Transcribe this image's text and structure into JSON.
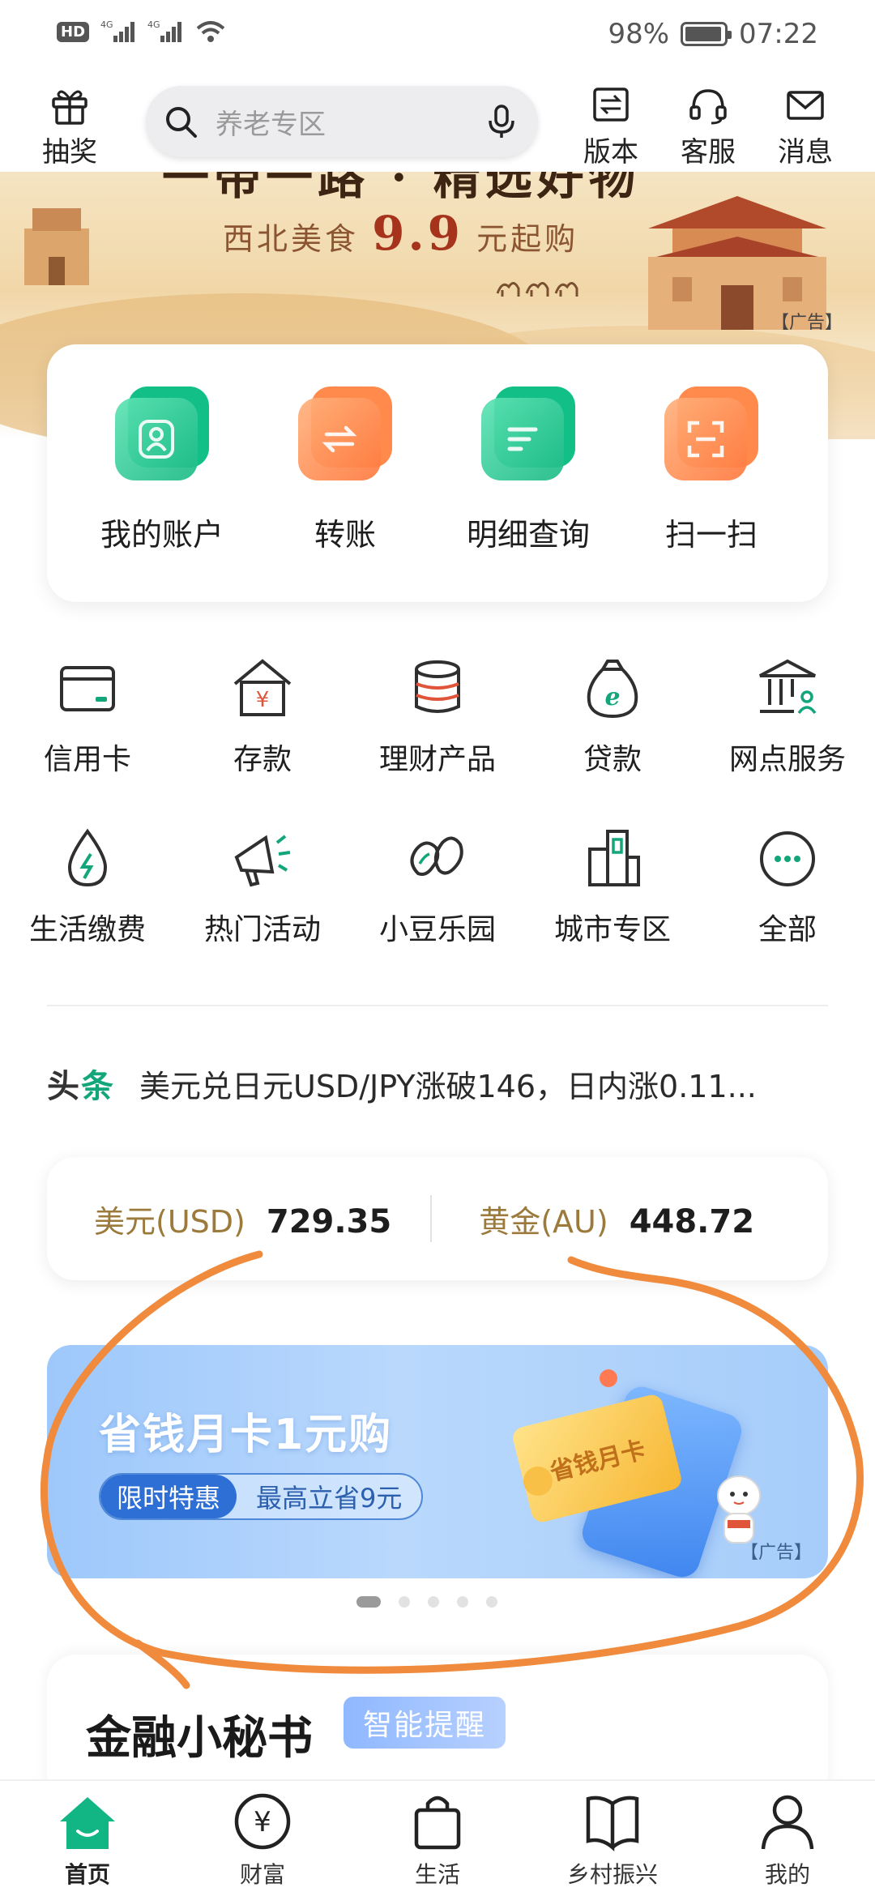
{
  "status_bar": {
    "left": "HD 4G 4G",
    "battery": "98%",
    "time": "07:22"
  },
  "top_bar": {
    "lottery_label": "抽奖",
    "search_placeholder": "养老专区",
    "version_label": "版本",
    "service_label": "客服",
    "messages_label": "消息"
  },
  "banner": {
    "title": "一带一路 · 精选好物",
    "sub_prefix": "西北美食",
    "sub_price": "9.9",
    "sub_suffix": "元起购",
    "ad_tag": "【广告】"
  },
  "main_actions": [
    {
      "label": "我的账户",
      "icon": "account-icon",
      "color": "#12c087"
    },
    {
      "label": "转账",
      "icon": "transfer-icon",
      "color": "#ff8a4c"
    },
    {
      "label": "明细查询",
      "icon": "details-icon",
      "color": "#12c087"
    },
    {
      "label": "扫一扫",
      "icon": "scan-icon",
      "color": "#ff8a4c"
    }
  ],
  "services_row1": [
    {
      "label": "信用卡",
      "icon": "credit-card-icon"
    },
    {
      "label": "存款",
      "icon": "deposit-icon"
    },
    {
      "label": "理财产品",
      "icon": "wealth-products-icon"
    },
    {
      "label": "贷款",
      "icon": "loan-icon"
    },
    {
      "label": "网点服务",
      "icon": "branch-service-icon"
    }
  ],
  "services_row2": [
    {
      "label": "生活缴费",
      "icon": "utility-payment-icon"
    },
    {
      "label": "热门活动",
      "icon": "megaphone-icon"
    },
    {
      "label": "小豆乐园",
      "icon": "beans-icon"
    },
    {
      "label": "城市专区",
      "icon": "city-icon"
    },
    {
      "label": "全部",
      "icon": "more-icon"
    }
  ],
  "headline": {
    "tag_a": "头",
    "tag_b": "条",
    "text": "美元兑日元USD/JPY涨破146，日内涨0.11..."
  },
  "rates": {
    "usd_name": "美元(USD)",
    "usd_value": "729.35",
    "gold_name": "黄金(AU)",
    "gold_value": "448.72"
  },
  "promo": {
    "title": "省钱月卡1元购",
    "pill_a": "限时特惠",
    "pill_b": "最高立省9元",
    "card_text": "省钱月卡",
    "ad_tag": "【广告】",
    "slides": 5,
    "active_slide": 1
  },
  "secretary": {
    "title": "金融小秘书",
    "badge": "智能提醒"
  },
  "bottom_nav": [
    {
      "label": "首页",
      "icon": "home-icon",
      "active": true
    },
    {
      "label": "财富",
      "icon": "wealth-icon",
      "active": false
    },
    {
      "label": "生活",
      "icon": "shopping-bag-icon",
      "active": false
    },
    {
      "label": "乡村振兴",
      "icon": "book-icon",
      "active": false
    },
    {
      "label": "我的",
      "icon": "profile-icon",
      "active": false
    }
  ],
  "colors": {
    "brand_green": "#12a67a",
    "accent_orange": "#ff8a4c",
    "annotation_orange": "#f08a3c",
    "gold_text": "#9b7a3c"
  }
}
